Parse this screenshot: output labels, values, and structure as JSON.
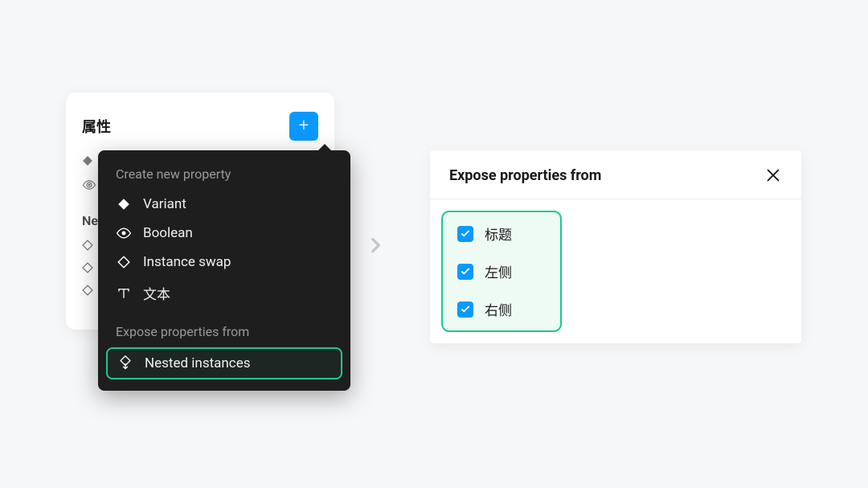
{
  "left": {
    "title": "属性",
    "nested_label": "Ne",
    "add_icon": "plus"
  },
  "menu": {
    "heading1": "Create new property",
    "items": [
      {
        "icon": "diamond-filled",
        "label": "Variant"
      },
      {
        "icon": "eye",
        "label": "Boolean"
      },
      {
        "icon": "diamond-outline",
        "label": "Instance swap"
      },
      {
        "icon": "text-t",
        "label": "文本"
      }
    ],
    "heading2": "Expose properties from",
    "nested": {
      "icon": "nested-up",
      "label": "Nested instances"
    }
  },
  "expose": {
    "title": "Expose properties from",
    "items": [
      {
        "label": "标题",
        "checked": true
      },
      {
        "label": "左侧",
        "checked": true
      },
      {
        "label": "右侧",
        "checked": true
      }
    ]
  },
  "colors": {
    "accent_blue": "#0b99ff",
    "highlight_green": "#1ec98b"
  }
}
